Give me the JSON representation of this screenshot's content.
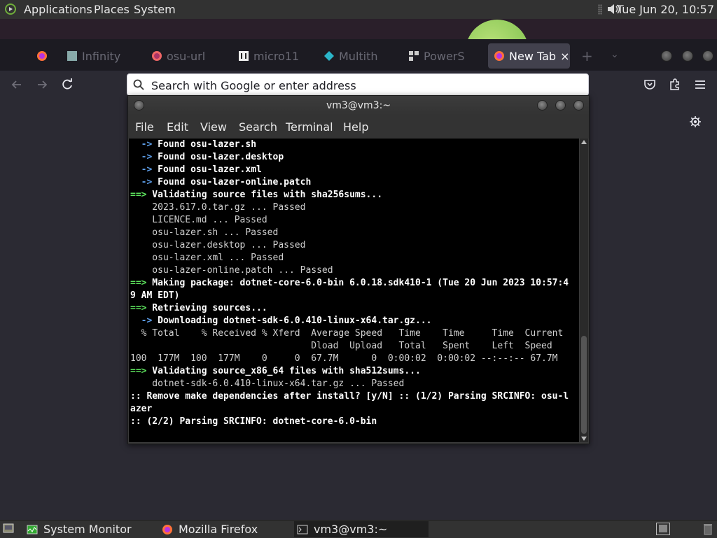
{
  "top_panel": {
    "menu": [
      "Applications",
      "Places",
      "System"
    ],
    "clock": "Tue Jun 20, 10:57",
    "icons": {
      "apps": "gnome-foot-icon",
      "volume": "volume-icon"
    }
  },
  "firefox": {
    "tabs": [
      {
        "label": "",
        "icon": "firefox-icon"
      },
      {
        "label": "Infinity",
        "icon": "page-icon"
      },
      {
        "label": "osu-url",
        "icon": "firefox-icon"
      },
      {
        "label": "micro11",
        "icon": "page-icon"
      },
      {
        "label": "Multith",
        "icon": "page-icon"
      },
      {
        "label": "PowerS",
        "icon": "page-icon"
      },
      {
        "label": "New Tab",
        "icon": "firefox-icon",
        "active": true
      }
    ],
    "urlbar_placeholder": "Search with Google or enter address",
    "close_glyph": "×",
    "new_tab_glyph": "+",
    "tab_list_glyph": "⌄"
  },
  "terminal": {
    "title": "vm3@vm3:~",
    "menu": [
      "File",
      "Edit",
      "View",
      "Search",
      "Terminal",
      "Help"
    ],
    "lines": [
      [
        {
          "t": "  ",
          "c": ""
        },
        {
          "t": "->",
          "c": "bl"
        },
        {
          "t": " Found osu-lazer.sh",
          "c": "b"
        }
      ],
      [
        {
          "t": "  ",
          "c": ""
        },
        {
          "t": "->",
          "c": "bl"
        },
        {
          "t": " Found osu-lazer.desktop",
          "c": "b"
        }
      ],
      [
        {
          "t": "  ",
          "c": ""
        },
        {
          "t": "->",
          "c": "bl"
        },
        {
          "t": " Found osu-lazer.xml",
          "c": "b"
        }
      ],
      [
        {
          "t": "  ",
          "c": ""
        },
        {
          "t": "->",
          "c": "bl"
        },
        {
          "t": " Found osu-lazer-online.patch",
          "c": "b"
        }
      ],
      [
        {
          "t": "==>",
          "c": "g"
        },
        {
          "t": " Validating source files with sha256sums...",
          "c": "b"
        }
      ],
      [
        {
          "t": "    2023.617.0.tar.gz ... Passed",
          "c": ""
        }
      ],
      [
        {
          "t": "    LICENCE.md ... Passed",
          "c": ""
        }
      ],
      [
        {
          "t": "    osu-lazer.sh ... Passed",
          "c": ""
        }
      ],
      [
        {
          "t": "    osu-lazer.desktop ... Passed",
          "c": ""
        }
      ],
      [
        {
          "t": "    osu-lazer.xml ... Passed",
          "c": ""
        }
      ],
      [
        {
          "t": "    osu-lazer-online.patch ... Passed",
          "c": ""
        }
      ],
      [
        {
          "t": "==>",
          "c": "g"
        },
        {
          "t": " Making package: dotnet-core-6.0-bin 6.0.18.sdk410-1 (Tue 20 Jun 2023 10:57:4",
          "c": "b"
        }
      ],
      [
        {
          "t": "9 AM EDT)",
          "c": "b"
        }
      ],
      [
        {
          "t": "==>",
          "c": "g"
        },
        {
          "t": " Retrieving sources...",
          "c": "b"
        }
      ],
      [
        {
          "t": "  ",
          "c": ""
        },
        {
          "t": "->",
          "c": "bl"
        },
        {
          "t": " Downloading dotnet-sdk-6.0.410-linux-x64.tar.gz...",
          "c": "b"
        }
      ],
      [
        {
          "t": "  % Total    % Received % Xferd  Average Speed   Time    Time     Time  Current",
          "c": ""
        }
      ],
      [
        {
          "t": "                                 Dload  Upload   Total   Spent    Left  Speed",
          "c": ""
        }
      ],
      [
        {
          "t": "100  177M  100  177M    0     0  67.7M      0  0:00:02  0:00:02 --:--:-- 67.7M",
          "c": ""
        }
      ],
      [
        {
          "t": "==>",
          "c": "g"
        },
        {
          "t": " Validating source_x86_64 files with sha512sums...",
          "c": "b"
        }
      ],
      [
        {
          "t": "    dotnet-sdk-6.0.410-linux-x64.tar.gz ... Passed",
          "c": ""
        }
      ],
      [
        {
          "t": ":: Remove make dependencies after install? [y/N] :: (1/2) Parsing SRCINFO: osu-l",
          "c": "b"
        }
      ],
      [
        {
          "t": "azer",
          "c": "b"
        }
      ],
      [
        {
          "t": ":: (2/2) Parsing SRCINFO: dotnet-core-6.0-bin",
          "c": "b"
        }
      ]
    ]
  },
  "bottom_panel": {
    "tasks": [
      {
        "label": "System Monitor",
        "icon": "system-monitor-icon"
      },
      {
        "label": "Mozilla Firefox",
        "icon": "firefox-icon"
      },
      {
        "label": "vm3@vm3:~",
        "icon": "terminal-icon",
        "active": true
      }
    ]
  },
  "colors": {
    "terminal_bg": "#000000",
    "prompt_green": "#5ce05c",
    "arrow_blue": "#5c9ce6",
    "panel": "#323232"
  }
}
